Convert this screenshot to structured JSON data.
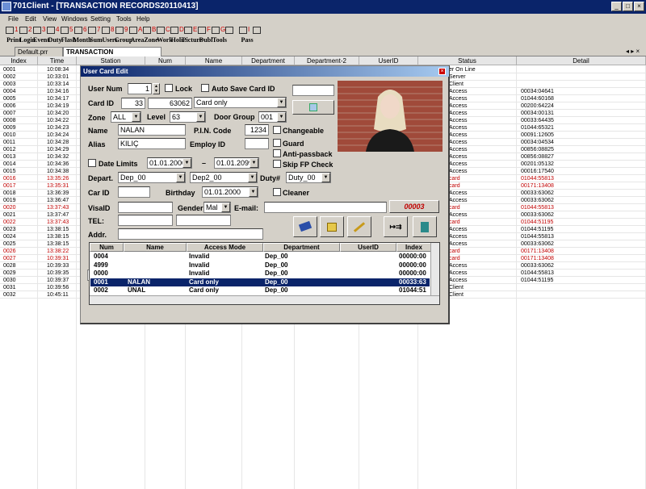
{
  "window": {
    "title": "701Client - [TRANSACTION RECORDS20110413]"
  },
  "menu": [
    "File",
    "Edit",
    "View",
    "Windows",
    "Setting",
    "Tools",
    "Help"
  ],
  "toolbar": [
    {
      "num": "1",
      "label": "Print"
    },
    {
      "num": "2",
      "label": "Login"
    },
    {
      "num": "3",
      "label": "Event"
    },
    {
      "num": "4",
      "label": "Duty"
    },
    {
      "num": "5",
      "label": "Flash"
    },
    {
      "num": "6",
      "label": "Month"
    },
    {
      "num": "7",
      "label": "Sum"
    },
    {
      "num": "8",
      "label": "Users"
    },
    {
      "num": "9",
      "label": "Group"
    },
    {
      "num": "A",
      "label": "Area"
    },
    {
      "num": "B",
      "label": "Zone"
    },
    {
      "num": "C",
      "label": "Work"
    },
    {
      "num": "D",
      "label": "Holi.."
    },
    {
      "num": "E",
      "label": "Picture"
    },
    {
      "num": "F",
      "label": "Dubl"
    },
    {
      "num": "G",
      "label": "Tools"
    },
    {
      "num": "",
      "label": ""
    },
    {
      "num": "I",
      "label": "Pass"
    },
    {
      "num": "",
      "label": ""
    }
  ],
  "tabs": [
    "Default.prr",
    "TRANSACTION RECORDS20110413"
  ],
  "grid": {
    "columns": [
      "Index",
      "Time",
      "Station",
      "Num",
      "Name",
      "Department",
      "Department-2",
      "UserID",
      "Status",
      "Detail"
    ],
    "rows": [
      {
        "index": "0001",
        "time": "10:08:34",
        "status": "er On Line",
        "detail": "",
        "red": false
      },
      {
        "index": "0002",
        "time": "10:33:01",
        "status": "Server",
        "detail": "",
        "red": false
      },
      {
        "index": "0003",
        "time": "10:33:14",
        "status": "Client",
        "detail": "",
        "red": false
      },
      {
        "index": "0004",
        "time": "10:34:16",
        "status": "Access",
        "detail": "00034:04641",
        "red": false
      },
      {
        "index": "0005",
        "time": "10:34:17",
        "status": "Access",
        "detail": "01044:60168",
        "red": false
      },
      {
        "index": "0006",
        "time": "10:34:19",
        "status": "Access",
        "detail": "00200:64224",
        "red": false
      },
      {
        "index": "0007",
        "time": "10:34:20",
        "status": "Access",
        "detail": "00034:00131",
        "red": false
      },
      {
        "index": "0008",
        "time": "10:34:22",
        "status": "Access",
        "detail": "00033:64435",
        "red": false
      },
      {
        "index": "0009",
        "time": "10:34:23",
        "status": "Access",
        "detail": "01044:65321",
        "red": false
      },
      {
        "index": "0010",
        "time": "10:34:24",
        "status": "Access",
        "detail": "00091:12605",
        "red": false
      },
      {
        "index": "0011",
        "time": "10:34:28",
        "status": "Access",
        "detail": "00034:04534",
        "red": false
      },
      {
        "index": "0012",
        "time": "10:34:29",
        "status": "Access",
        "detail": "00856:08825",
        "red": false
      },
      {
        "index": "0013",
        "time": "10:34:32",
        "status": "Access",
        "detail": "00856:08827",
        "red": false
      },
      {
        "index": "0014",
        "time": "10:34:36",
        "status": "Access",
        "detail": "00201:05132",
        "red": false
      },
      {
        "index": "0015",
        "time": "10:34:38",
        "status": "Access",
        "detail": "00016:17540",
        "red": false
      },
      {
        "index": "0016",
        "time": "13:35:26",
        "status": "card",
        "detail": "01044:55813",
        "red": true
      },
      {
        "index": "0017",
        "time": "13:35:31",
        "status": "card",
        "detail": "00171:13408",
        "red": true
      },
      {
        "index": "0018",
        "time": "13:36:39",
        "status": "Access",
        "detail": "00033:63062",
        "red": false
      },
      {
        "index": "0019",
        "time": "13:36:47",
        "status": "Access",
        "detail": "00033:63062",
        "red": false
      },
      {
        "index": "0020",
        "time": "13:37:43",
        "status": "card",
        "detail": "01044:55813",
        "red": true
      },
      {
        "index": "0021",
        "time": "13:37:47",
        "status": "Access",
        "detail": "00033:63062",
        "red": false
      },
      {
        "index": "0022",
        "time": "13:37:43",
        "status": "card",
        "detail": "01044:51195",
        "red": true
      },
      {
        "index": "0023",
        "time": "13:38:15",
        "status": "Access",
        "detail": "01044:51195",
        "red": false
      },
      {
        "index": "0024",
        "time": "13:38:15",
        "status": "Access",
        "detail": "01044:55813",
        "red": false
      },
      {
        "index": "0025",
        "time": "13:38:15",
        "status": "Access",
        "detail": "00033:63062",
        "red": false
      },
      {
        "index": "0026",
        "time": "13:38:22",
        "status": "card",
        "detail": "00171:13408",
        "red": true
      },
      {
        "index": "0027",
        "time": "10:39:31",
        "status": "card",
        "detail": "00171:13408",
        "red": true
      },
      {
        "index": "0028",
        "time": "10:39:33",
        "status": "Access",
        "detail": "00033:63062",
        "red": false
      },
      {
        "index": "0029",
        "time": "10:39:35",
        "status": "Access",
        "detail": "01044:55813",
        "red": false
      },
      {
        "index": "0030",
        "time": "10:39:37",
        "status": "Access",
        "detail": "01044:51195",
        "red": false
      },
      {
        "index": "0031",
        "time": "10:39:56",
        "status": "Client",
        "detail": "",
        "red": false
      },
      {
        "index": "0032",
        "time": "10:45:11",
        "status": "Client",
        "detail": "",
        "red": false
      }
    ]
  },
  "dialog": {
    "title": "User Card Edit",
    "user_num_label": "User Num",
    "user_num": "1",
    "lock_label": "Lock",
    "auto_save_label": "Auto Save Card ID",
    "card_id_label": "Card ID",
    "card_id_a": "33",
    "card_id_b": "63062",
    "card_mode": "Card only",
    "zone_label": "Zone",
    "zone": "ALL",
    "level_label": "Level",
    "level": "63",
    "door_group_label": "Door Group",
    "door_group": "001",
    "name_label": "Name",
    "name": "NALAN",
    "pin_label": "P.I.N. Code",
    "pin": "1234",
    "changeable_label": "Changeable",
    "alias_label": "Alias",
    "alias": "KILIÇ",
    "employ_label": "Employ ID",
    "guard_label": "Guard",
    "antipassback_label": "Anti-passback",
    "skipfp_label": "Skip FP Check",
    "date_limits_label": "Date Limits",
    "date_from": "01.01.2000",
    "date_to": "01.01.2099",
    "depart_label": "Depart.",
    "depart": "Dep_00",
    "depart2": "Dep2_00",
    "duty_label": "Duty#",
    "duty": "Duty_00",
    "car_id_label": "Car ID",
    "birthday_label": "Birthday",
    "birthday": "01.01.2000",
    "cleaner_label": "Cleaner",
    "visa_label": "VisaID",
    "gender_label": "Gender",
    "gender": "Mal",
    "email_label": "E-mail:",
    "tel_label": "TEL:",
    "addr_label": "Addr.",
    "red_code": "00003",
    "list_columns": [
      "Num",
      "Name",
      "Access Mode",
      "Department",
      "UserID",
      "Index"
    ],
    "list_rows": [
      {
        "num": "0004",
        "name": "",
        "mode": "Invalid",
        "dept": "Dep_00",
        "uid": "",
        "index": "00000:00",
        "sel": false
      },
      {
        "num": "4999",
        "name": "",
        "mode": "Invalid",
        "dept": "Dep_00",
        "uid": "",
        "index": "00000:00",
        "sel": false
      },
      {
        "num": "0000",
        "name": "",
        "mode": "Invalid",
        "dept": "Dep_00",
        "uid": "",
        "index": "00000:00",
        "sel": false
      },
      {
        "num": "0001",
        "name": "NALAN",
        "mode": "Card only",
        "dept": "Dep_00",
        "uid": "",
        "index": "00033:63",
        "sel": true
      },
      {
        "num": "0002",
        "name": "ÜNAL",
        "mode": "Card only",
        "dept": "Dep_00",
        "uid": "",
        "index": "01044:51",
        "sel": false
      }
    ]
  },
  "colors": {
    "title_bg": "#0a246a",
    "selection": "#0a246a",
    "red_text": "#c00000"
  }
}
